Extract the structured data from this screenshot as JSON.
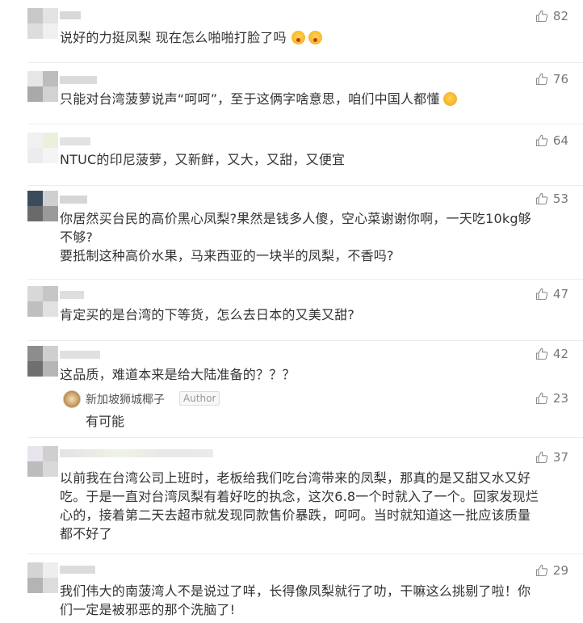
{
  "comments": [
    {
      "text": "说好的力挺凤梨  现在怎么啪啪打脸了吗",
      "likes": "82",
      "emojis": [
        "flushed-face",
        "flushed-face"
      ]
    },
    {
      "text": "只能对台湾菠萝说声“呵呵”，至于这俩字啥意思，咱们中国人都懂",
      "likes": "76",
      "emojis": [
        "thinking-face"
      ]
    },
    {
      "text": "NTUC的印尼菠萝，又新鲜，又大，又甜，又便宜",
      "likes": "64"
    },
    {
      "lines": [
        "你居然买台民的高价黑心凤梨?果然是钱多人傻，空心菜谢谢你啊，一天吃10kg够",
        "不够?",
        "要抵制这种高价水果，马来西亚的一块半的凤梨，不香吗?"
      ],
      "likes": "53"
    },
    {
      "text": "肯定买的是台湾的下等货，怎么去日本的又美又甜?",
      "likes": "47"
    },
    {
      "text": "这品质，难道本来是给大陆准备的？？？",
      "likes": "42",
      "reply": {
        "name": "新加坡狮城椰子",
        "badge": "Author",
        "text": "有可能",
        "likes": "23"
      }
    },
    {
      "lines": [
        "以前我在台湾公司上班时，老板给我们吃台湾带来的凤梨，那真的是又甜又水又好",
        "吃。于是一直对台湾凤梨有着好吃的执念，这次6.8一个时就入了一个。回家发现烂",
        "心的，接着第二天去超市就发现同款售价暴跌，呵呵。当时就知道这一批应该质量",
        "都不好了"
      ],
      "likes": "37"
    },
    {
      "lines": [
        "我们伟大的南菠湾人不是说过了咩，长得像凤梨就行了叻，干嘛这么挑剔了啦！你",
        "们一定是被邪恶的那个洗脑了!"
      ],
      "likes": "29"
    }
  ]
}
